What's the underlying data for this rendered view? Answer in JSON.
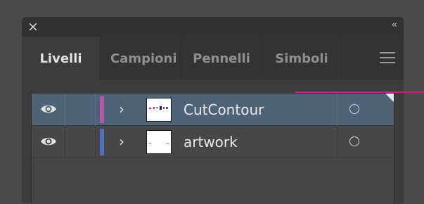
{
  "window": {
    "close_glyph": "×",
    "collapse_glyph": "‹‹"
  },
  "tabs": [
    {
      "label": "Livelli",
      "active": true
    },
    {
      "label": "Campioni",
      "active": false
    },
    {
      "label": "Pennelli",
      "active": false
    },
    {
      "label": "Simboli",
      "active": false
    }
  ],
  "icons": {
    "close": "close-icon",
    "collapse": "double-chevron-left-icon",
    "menu": "hamburger-menu-icon",
    "visibility": "eye-icon",
    "expand": "chevron-right-icon",
    "target": "circle-target-icon"
  },
  "layers": [
    {
      "name": "CutContour",
      "color": "#b05aa8",
      "selected": true,
      "visible": true
    },
    {
      "name": "artwork",
      "color": "#4f6fb8",
      "selected": false,
      "visible": true
    }
  ],
  "colors": {
    "selection_row": "#4e6378",
    "selection_line": "#d01b86"
  }
}
